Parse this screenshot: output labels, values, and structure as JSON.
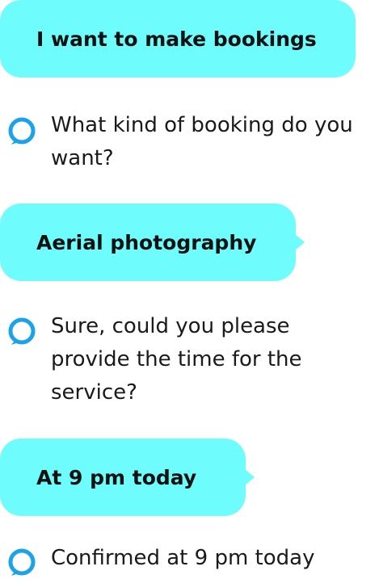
{
  "conversation": {
    "user_messages": [
      {
        "text": "I want to make bookings"
      },
      {
        "text": "Aerial photography"
      },
      {
        "text": "At 9 pm today"
      }
    ],
    "assistant_messages": [
      {
        "text": "What kind of booking do you\nwant?",
        "icon": "alexa-ring-icon"
      },
      {
        "text": "Sure, could you please\nprovide the time for the\nservice?",
        "icon": "alexa-ring-icon"
      },
      {
        "text": "Confirmed at 9 pm today",
        "icon": "alexa-ring-icon"
      }
    ]
  },
  "colors": {
    "user_bubble": "#6ffcfd",
    "assistant_icon": "#1aa3e8",
    "text": "#1a1a1a"
  }
}
